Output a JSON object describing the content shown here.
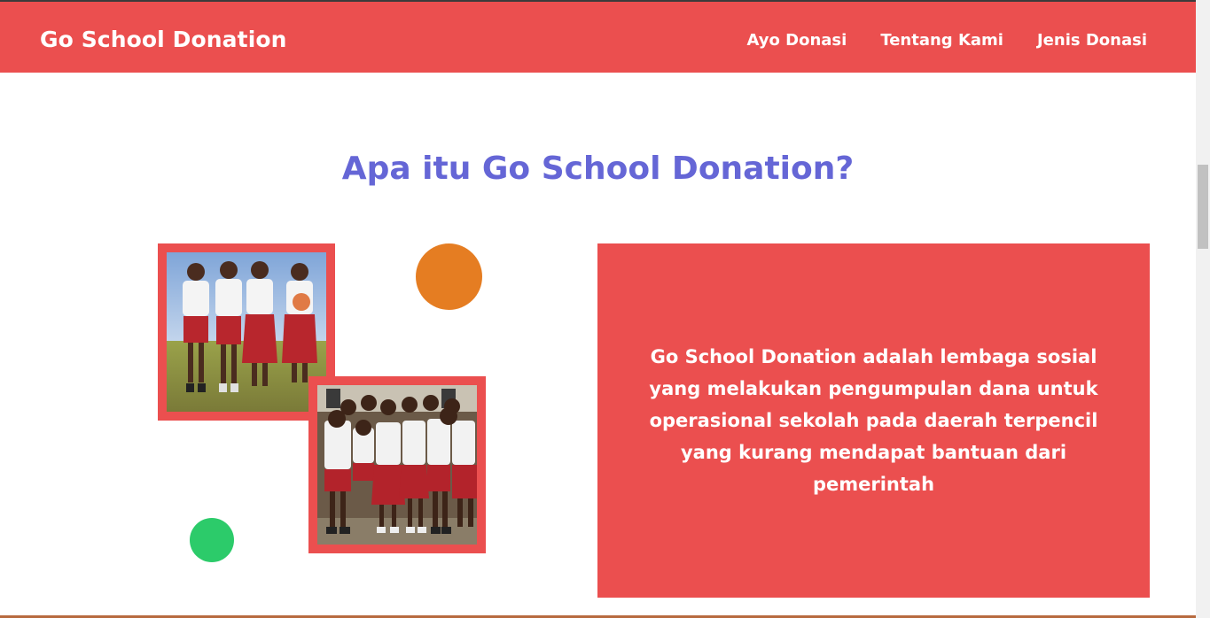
{
  "navbar": {
    "brand": "Go School Donation",
    "links": [
      "Ayo Donasi",
      "Tentang Kami",
      "Jenis Donasi"
    ]
  },
  "about": {
    "title": "Apa itu Go School Donation?",
    "description": "Go School Donation adalah lembaga sosial yang melakukan pengumpulan dana untuk operasional sekolah pada daerah terpencil yang kurang mendapat bantuan dari pemerintah",
    "photos": [
      "students-photo",
      "students-group-photo"
    ]
  },
  "colors": {
    "primary": "#eb4f4f",
    "title": "#6566d6",
    "accent_orange": "#e57d22",
    "accent_green": "#2ccb6a"
  }
}
